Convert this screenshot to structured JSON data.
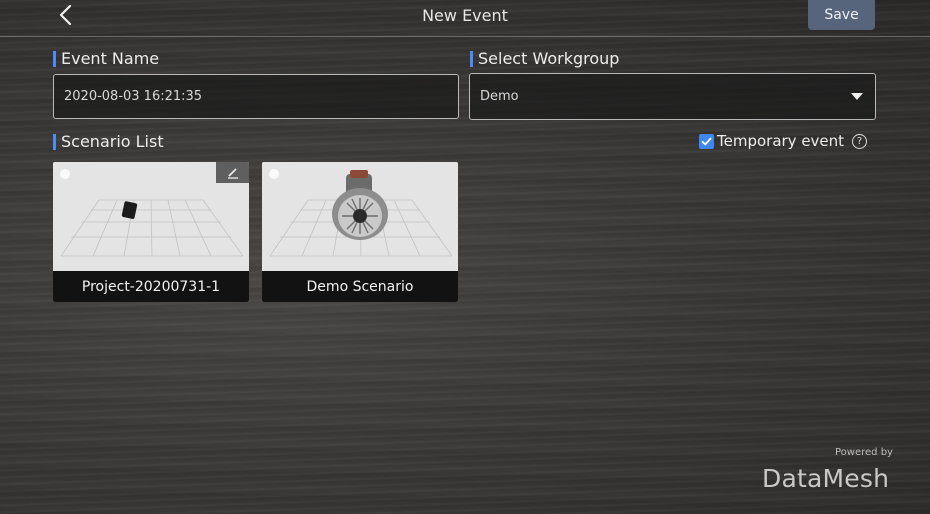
{
  "header": {
    "title": "New Event",
    "save_label": "Save",
    "back_icon": "chevron-left-icon"
  },
  "form": {
    "event_name_label": "Event Name",
    "event_name_value": "2020-08-03 16:21:35",
    "workgroup_label": "Select Workgroup",
    "workgroup_value": "Demo"
  },
  "scenarios": {
    "label": "Scenario List",
    "temporary_label": "Temporary event",
    "temporary_checked": true,
    "items": [
      {
        "name": "Project-20200731-1",
        "editable": true
      },
      {
        "name": "Demo Scenario",
        "editable": false
      }
    ]
  },
  "footer": {
    "powered_by": "Powered by",
    "brand": "DataMesh"
  },
  "colors": {
    "accent": "#4d8cf5",
    "save_button": "#56657b",
    "checkbox": "#3f86f0"
  }
}
